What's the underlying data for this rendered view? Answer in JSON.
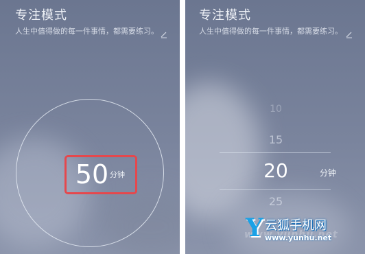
{
  "screens": {
    "left": {
      "title": "专注模式",
      "subtitle": "人生中值得做的每一件事情，都需要练习。",
      "timer": {
        "value": "50",
        "unit": "分钟"
      }
    },
    "right": {
      "title": "专注模式",
      "subtitle": "人生中值得做的每一件事情，都需要练习。",
      "picker": {
        "options": [
          "10",
          "15",
          "20",
          "25"
        ],
        "selected": "20",
        "unit": "分钟"
      }
    }
  },
  "watermark": {
    "letter": "Y",
    "name": "云狐手机网",
    "url": "www.yunhu.net"
  },
  "colors": {
    "background_top": "#6b7690",
    "background_bottom": "#8b94ab",
    "highlight_border": "#e5484d",
    "watermark_blue": "#1aa1e6"
  },
  "icons": {
    "edit": "pencil-icon"
  }
}
